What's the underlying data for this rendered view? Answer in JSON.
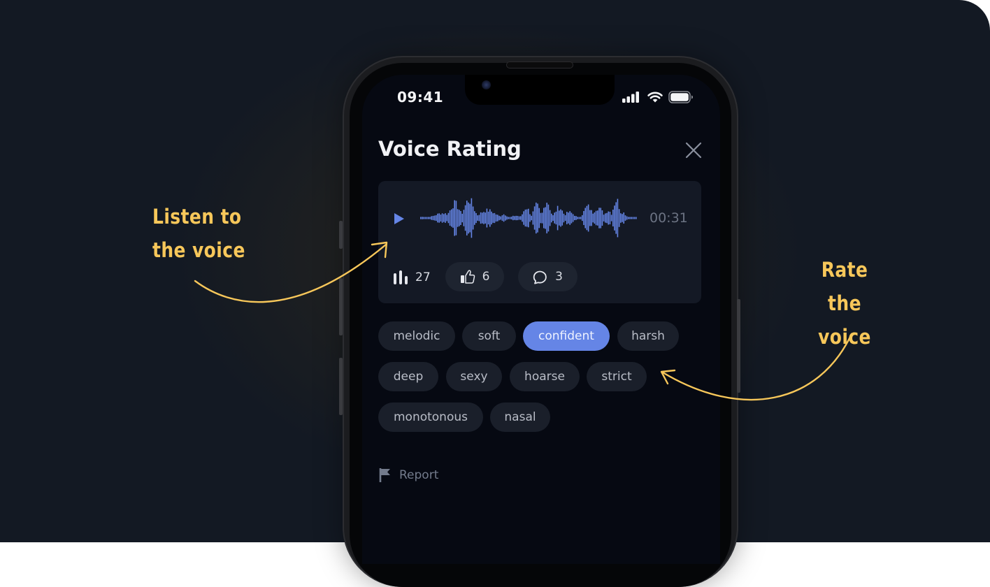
{
  "status_bar": {
    "time": "09:41",
    "icons": [
      "cellular-signal-icon",
      "wifi-icon",
      "battery-icon"
    ]
  },
  "header": {
    "title": "Voice Rating",
    "close_icon": "close-icon"
  },
  "player": {
    "play_icon": "play-icon",
    "duration": "00:31",
    "accent_color": "#6585e6",
    "waveform_icon": "waveform"
  },
  "stats": {
    "plays": {
      "icon": "bar-chart-icon",
      "count": "27"
    },
    "likes": {
      "icon": "thumbs-up-icon",
      "count": "6"
    },
    "comments": {
      "icon": "comment-bubble-icon",
      "count": "3"
    }
  },
  "tags": [
    {
      "label": "melodic",
      "selected": false
    },
    {
      "label": "soft",
      "selected": false
    },
    {
      "label": "confident",
      "selected": true
    },
    {
      "label": "harsh",
      "selected": false
    },
    {
      "label": "deep",
      "selected": false
    },
    {
      "label": "sexy",
      "selected": false
    },
    {
      "label": "hoarse",
      "selected": false
    },
    {
      "label": "strict",
      "selected": false
    },
    {
      "label": "monotonous",
      "selected": false
    },
    {
      "label": "nasal",
      "selected": false
    }
  ],
  "report": {
    "icon": "flag-icon",
    "label": "Report"
  },
  "annotations": {
    "left_line1": "Listen to",
    "left_line2": "the voice",
    "right_line1": "Rate",
    "right_line2": "the voice",
    "color": "#f7c75a"
  }
}
